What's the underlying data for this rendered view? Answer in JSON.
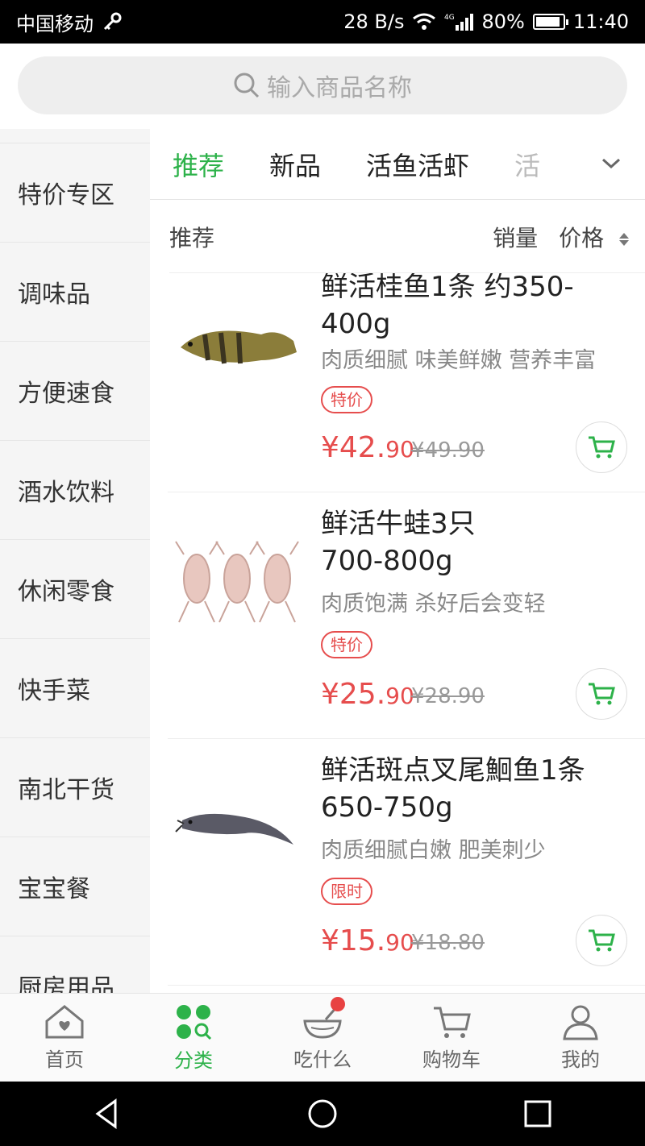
{
  "status": {
    "carrier": "中国移动",
    "speed": "28 B/s",
    "battery": "80%",
    "time": "11:40"
  },
  "search": {
    "placeholder": "输入商品名称"
  },
  "sidebar": {
    "items": [
      {
        "label": "特价专区"
      },
      {
        "label": "调味品"
      },
      {
        "label": "方便速食"
      },
      {
        "label": "酒水饮料"
      },
      {
        "label": "休闲零食"
      },
      {
        "label": "快手菜"
      },
      {
        "label": "南北干货"
      },
      {
        "label": "宝宝餐"
      },
      {
        "label": "厨房用品"
      }
    ]
  },
  "tabs": [
    {
      "label": "推荐"
    },
    {
      "label": "新品"
    },
    {
      "label": "活鱼活虾"
    },
    {
      "label": "活"
    }
  ],
  "sort": {
    "title": "推荐",
    "sales": "销量",
    "price": "价格"
  },
  "products": [
    {
      "name": "鲜活桂鱼1条 约350-400g",
      "desc": "肉质细腻 味美鲜嫩 营养丰富",
      "tag": "特价",
      "price_int": "¥42.",
      "price_dec": "90",
      "old_price": "¥49.90"
    },
    {
      "name": "鲜活牛蛙3只\n700-800g",
      "desc": "肉质饱满 杀好后会变轻",
      "tag": "特价",
      "price_int": "¥25.",
      "price_dec": "90",
      "old_price": "¥28.90"
    },
    {
      "name": "鲜活斑点叉尾鮰鱼1条 650-750g",
      "desc": "肉质细腻白嫩 肥美刺少",
      "tag": "限时",
      "price_int": "¥15.",
      "price_dec": "90",
      "old_price": "¥18.80"
    }
  ],
  "bottom_nav": [
    {
      "label": "首页"
    },
    {
      "label": "分类"
    },
    {
      "label": "吃什么"
    },
    {
      "label": "购物车"
    },
    {
      "label": "我的"
    }
  ],
  "colors": {
    "accent": "#2db24a",
    "price": "#e64d4d"
  }
}
